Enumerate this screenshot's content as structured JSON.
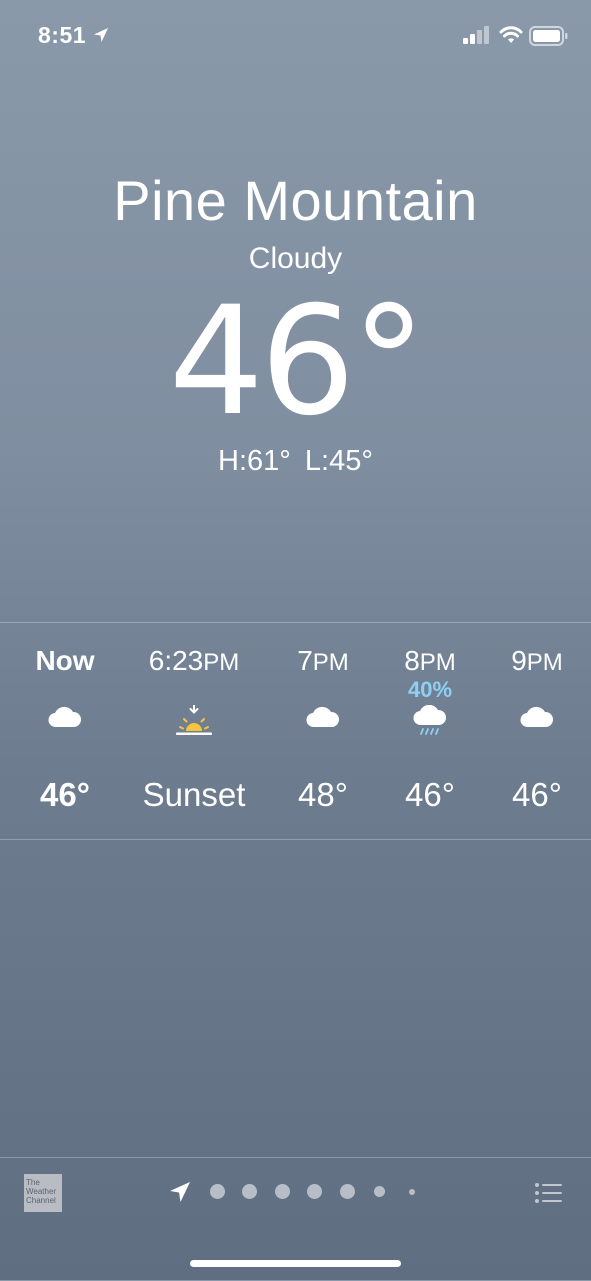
{
  "status_bar": {
    "time": "8:51",
    "icons": [
      "location-arrow-icon",
      "cellular-signal-icon",
      "wifi-icon",
      "battery-icon"
    ]
  },
  "current": {
    "location": "Pine Mountain",
    "condition": "Cloudy",
    "temperature": "46°",
    "high_low": "H:61°  L:45°"
  },
  "hourly": [
    {
      "time": "Now",
      "suffix": "",
      "icon": "cloud-icon",
      "precip": "",
      "value": "46°"
    },
    {
      "time": "6:23",
      "suffix": "PM",
      "icon": "sunset-icon",
      "precip": "",
      "value": "Sunset"
    },
    {
      "time": "7",
      "suffix": "PM",
      "icon": "cloud-icon",
      "precip": "",
      "value": "48°"
    },
    {
      "time": "8",
      "suffix": "PM",
      "icon": "rain-cloud-icon",
      "precip": "40%",
      "value": "46°"
    },
    {
      "time": "9",
      "suffix": "PM",
      "icon": "cloud-icon",
      "precip": "",
      "value": "46°"
    }
  ],
  "bottom_bar": {
    "logo_text": "The Weather Channel",
    "page_count": 7,
    "current_page": 0,
    "icons": [
      "location-arrow-icon",
      "list-icon"
    ]
  },
  "colors": {
    "precip": "#8dd0f5",
    "sun": "#f5c542"
  }
}
